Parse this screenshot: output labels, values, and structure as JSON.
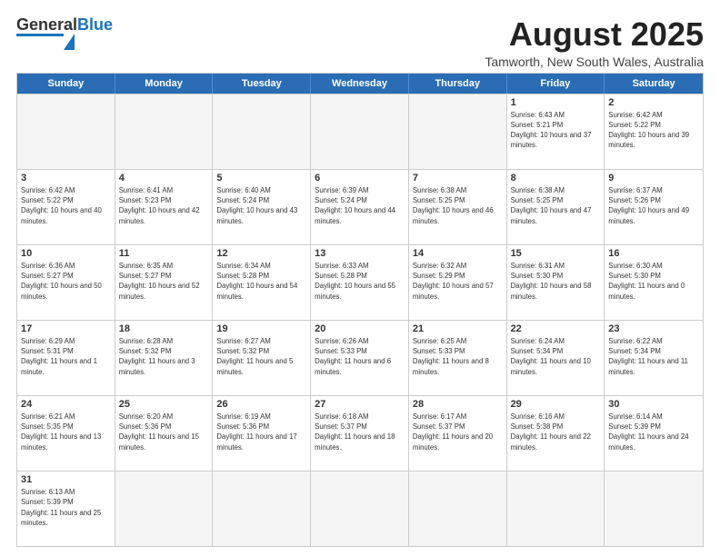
{
  "header": {
    "logo": {
      "general": "General",
      "blue": "Blue"
    },
    "month_title": "August 2025",
    "location": "Tamworth, New South Wales, Australia"
  },
  "calendar": {
    "days_of_week": [
      "Sunday",
      "Monday",
      "Tuesday",
      "Wednesday",
      "Thursday",
      "Friday",
      "Saturday"
    ],
    "weeks": [
      [
        {
          "day": "",
          "empty": true
        },
        {
          "day": "",
          "empty": true
        },
        {
          "day": "",
          "empty": true
        },
        {
          "day": "",
          "empty": true
        },
        {
          "day": "",
          "empty": true
        },
        {
          "day": "1",
          "sunrise": "6:43 AM",
          "sunset": "5:21 PM",
          "daylight": "10 hours and 37 minutes."
        },
        {
          "day": "2",
          "sunrise": "6:42 AM",
          "sunset": "5:22 PM",
          "daylight": "10 hours and 39 minutes."
        }
      ],
      [
        {
          "day": "3",
          "sunrise": "6:42 AM",
          "sunset": "5:22 PM",
          "daylight": "10 hours and 40 minutes."
        },
        {
          "day": "4",
          "sunrise": "6:41 AM",
          "sunset": "5:23 PM",
          "daylight": "10 hours and 42 minutes."
        },
        {
          "day": "5",
          "sunrise": "6:40 AM",
          "sunset": "5:24 PM",
          "daylight": "10 hours and 43 minutes."
        },
        {
          "day": "6",
          "sunrise": "6:39 AM",
          "sunset": "5:24 PM",
          "daylight": "10 hours and 44 minutes."
        },
        {
          "day": "7",
          "sunrise": "6:38 AM",
          "sunset": "5:25 PM",
          "daylight": "10 hours and 46 minutes."
        },
        {
          "day": "8",
          "sunrise": "6:38 AM",
          "sunset": "5:25 PM",
          "daylight": "10 hours and 47 minutes."
        },
        {
          "day": "9",
          "sunrise": "6:37 AM",
          "sunset": "5:26 PM",
          "daylight": "10 hours and 49 minutes."
        }
      ],
      [
        {
          "day": "10",
          "sunrise": "6:36 AM",
          "sunset": "5:27 PM",
          "daylight": "10 hours and 50 minutes."
        },
        {
          "day": "11",
          "sunrise": "6:35 AM",
          "sunset": "5:27 PM",
          "daylight": "10 hours and 52 minutes."
        },
        {
          "day": "12",
          "sunrise": "6:34 AM",
          "sunset": "5:28 PM",
          "daylight": "10 hours and 54 minutes."
        },
        {
          "day": "13",
          "sunrise": "6:33 AM",
          "sunset": "5:28 PM",
          "daylight": "10 hours and 55 minutes."
        },
        {
          "day": "14",
          "sunrise": "6:32 AM",
          "sunset": "5:29 PM",
          "daylight": "10 hours and 57 minutes."
        },
        {
          "day": "15",
          "sunrise": "6:31 AM",
          "sunset": "5:30 PM",
          "daylight": "10 hours and 58 minutes."
        },
        {
          "day": "16",
          "sunrise": "6:30 AM",
          "sunset": "5:30 PM",
          "daylight": "11 hours and 0 minutes."
        }
      ],
      [
        {
          "day": "17",
          "sunrise": "6:29 AM",
          "sunset": "5:31 PM",
          "daylight": "11 hours and 1 minute."
        },
        {
          "day": "18",
          "sunrise": "6:28 AM",
          "sunset": "5:32 PM",
          "daylight": "11 hours and 3 minutes."
        },
        {
          "day": "19",
          "sunrise": "6:27 AM",
          "sunset": "5:32 PM",
          "daylight": "11 hours and 5 minutes."
        },
        {
          "day": "20",
          "sunrise": "6:26 AM",
          "sunset": "5:33 PM",
          "daylight": "11 hours and 6 minutes."
        },
        {
          "day": "21",
          "sunrise": "6:25 AM",
          "sunset": "5:33 PM",
          "daylight": "11 hours and 8 minutes."
        },
        {
          "day": "22",
          "sunrise": "6:24 AM",
          "sunset": "5:34 PM",
          "daylight": "11 hours and 10 minutes."
        },
        {
          "day": "23",
          "sunrise": "6:22 AM",
          "sunset": "5:34 PM",
          "daylight": "11 hours and 11 minutes."
        }
      ],
      [
        {
          "day": "24",
          "sunrise": "6:21 AM",
          "sunset": "5:35 PM",
          "daylight": "11 hours and 13 minutes."
        },
        {
          "day": "25",
          "sunrise": "6:20 AM",
          "sunset": "5:36 PM",
          "daylight": "11 hours and 15 minutes."
        },
        {
          "day": "26",
          "sunrise": "6:19 AM",
          "sunset": "5:36 PM",
          "daylight": "11 hours and 17 minutes."
        },
        {
          "day": "27",
          "sunrise": "6:18 AM",
          "sunset": "5:37 PM",
          "daylight": "11 hours and 18 minutes."
        },
        {
          "day": "28",
          "sunrise": "6:17 AM",
          "sunset": "5:37 PM",
          "daylight": "11 hours and 20 minutes."
        },
        {
          "day": "29",
          "sunrise": "6:16 AM",
          "sunset": "5:38 PM",
          "daylight": "11 hours and 22 minutes."
        },
        {
          "day": "30",
          "sunrise": "6:14 AM",
          "sunset": "5:39 PM",
          "daylight": "11 hours and 24 minutes."
        }
      ],
      [
        {
          "day": "31",
          "sunrise": "6:13 AM",
          "sunset": "5:39 PM",
          "daylight": "11 hours and 25 minutes."
        },
        {
          "day": "",
          "empty": true
        },
        {
          "day": "",
          "empty": true
        },
        {
          "day": "",
          "empty": true
        },
        {
          "day": "",
          "empty": true
        },
        {
          "day": "",
          "empty": true
        },
        {
          "day": "",
          "empty": true
        }
      ]
    ]
  }
}
